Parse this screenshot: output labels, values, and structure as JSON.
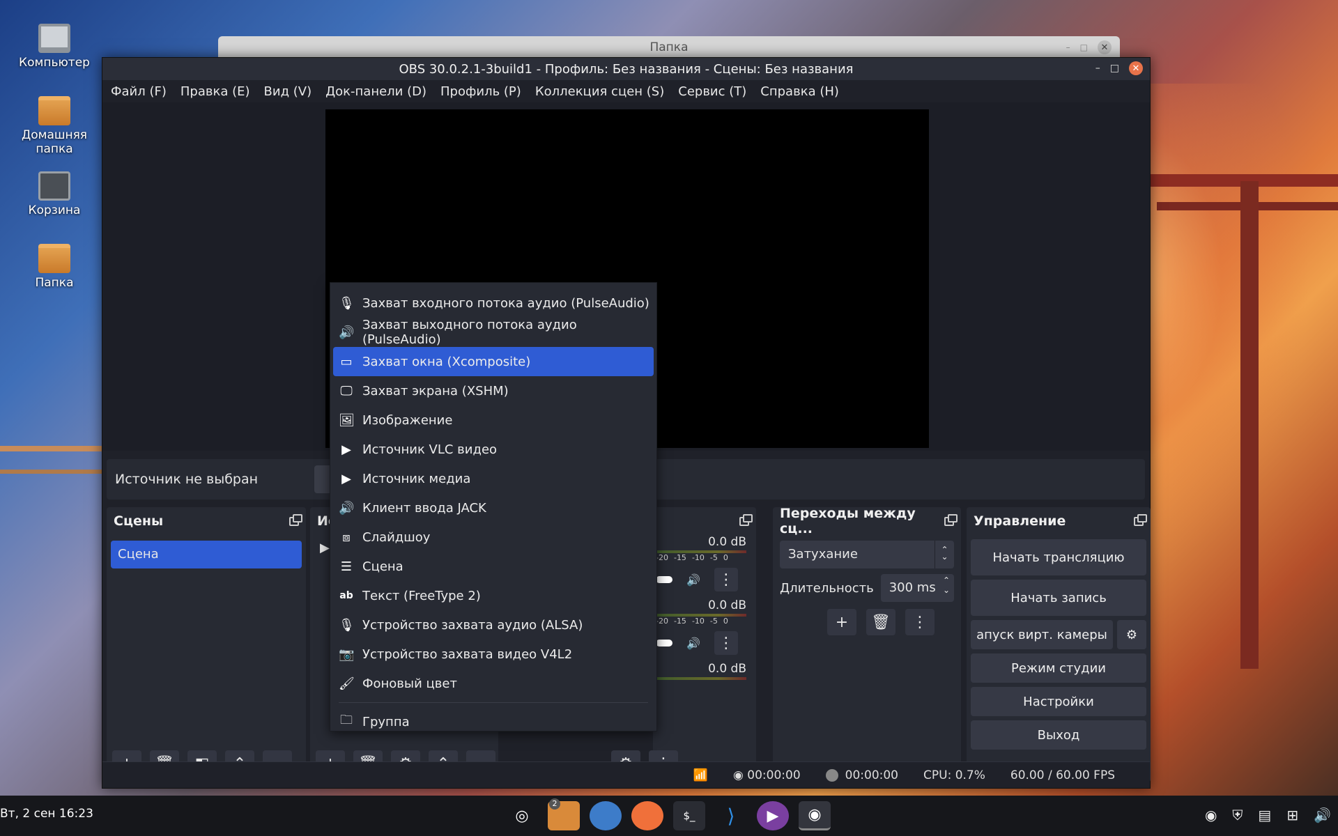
{
  "desktop": {
    "icons": [
      {
        "label": "Компьютер"
      },
      {
        "label": "Домашняя папка"
      },
      {
        "label": "Корзина"
      },
      {
        "label": "Папка"
      }
    ]
  },
  "background_window": {
    "title": "Папка"
  },
  "obs": {
    "title": "OBS 30.0.2.1-3build1 - Профиль: Без названия - Сцены: Без названия",
    "menu": [
      "Файл (F)",
      "Правка (E)",
      "Вид (V)",
      "Док-панели (D)",
      "Профиль (P)",
      "Коллекция сцен (S)",
      "Сервис (T)",
      "Справка (H)"
    ],
    "source_status": "Источник не выбран",
    "scenes": {
      "title": "Сцены",
      "items": [
        "Сцена"
      ]
    },
    "sources": {
      "title": "Ис"
    },
    "mixer": {
      "channels": [
        {
          "db": "0.0 dB",
          "scale": [
            "-20",
            "-15",
            "-10",
            "-5",
            "0"
          ]
        },
        {
          "db": "0.0 dB",
          "scale": [
            "-20",
            "-15",
            "-10",
            "-5",
            "0"
          ]
        },
        {
          "db": "0.0 dB"
        }
      ]
    },
    "transitions": {
      "title": "Переходы между сц...",
      "selected": "Затухание",
      "duration_label": "Длительность",
      "duration_value": "300 ms"
    },
    "controls": {
      "title": "Управление",
      "start_stream": "Начать трансляцию",
      "start_record": "Начать запись",
      "virtual_cam": "апуск вирт. камеры",
      "studio_mode": "Режим студии",
      "settings": "Настройки",
      "exit": "Выход"
    },
    "status": {
      "stream_time": "00:00:00",
      "record_time": "00:00:00",
      "cpu": "CPU: 0.7%",
      "fps": "60.00 / 60.00 FPS"
    }
  },
  "context_menu": {
    "items": [
      {
        "label": "Захват входного потока аудио (PulseAudio)",
        "icon": "microphone-icon"
      },
      {
        "label": "Захват выходного потока аудио (PulseAudio)",
        "icon": "speaker-icon"
      },
      {
        "label": "Захват окна (Xcomposite)",
        "icon": "window-icon",
        "active": true
      },
      {
        "label": "Захват экрана (XSHM)",
        "icon": "monitor-icon"
      },
      {
        "label": "Изображение",
        "icon": "image-icon"
      },
      {
        "label": "Источник VLC видео",
        "icon": "play-icon"
      },
      {
        "label": "Источник медиа",
        "icon": "play-icon"
      },
      {
        "label": "Клиент ввода JACK",
        "icon": "speaker-icon"
      },
      {
        "label": "Слайдшоу",
        "icon": "slideshow-icon"
      },
      {
        "label": "Сцена",
        "icon": "list-icon"
      },
      {
        "label": "Текст (FreeType 2)",
        "icon": "text-icon"
      },
      {
        "label": "Устройство захвата аудио (ALSA)",
        "icon": "microphone-icon"
      },
      {
        "label": "Устройство захвата видео V4L2",
        "icon": "camera-icon"
      },
      {
        "label": "Фоновый цвет",
        "icon": "brush-icon"
      },
      {
        "label": "Группа",
        "icon": "folder-icon"
      }
    ]
  },
  "taskbar": {
    "clock": "Вт,  2 сен 16:23",
    "files_badge": "2"
  },
  "colors": {
    "accent": "#2f5cd4",
    "panel": "#272a33",
    "window": "#1f2129"
  }
}
